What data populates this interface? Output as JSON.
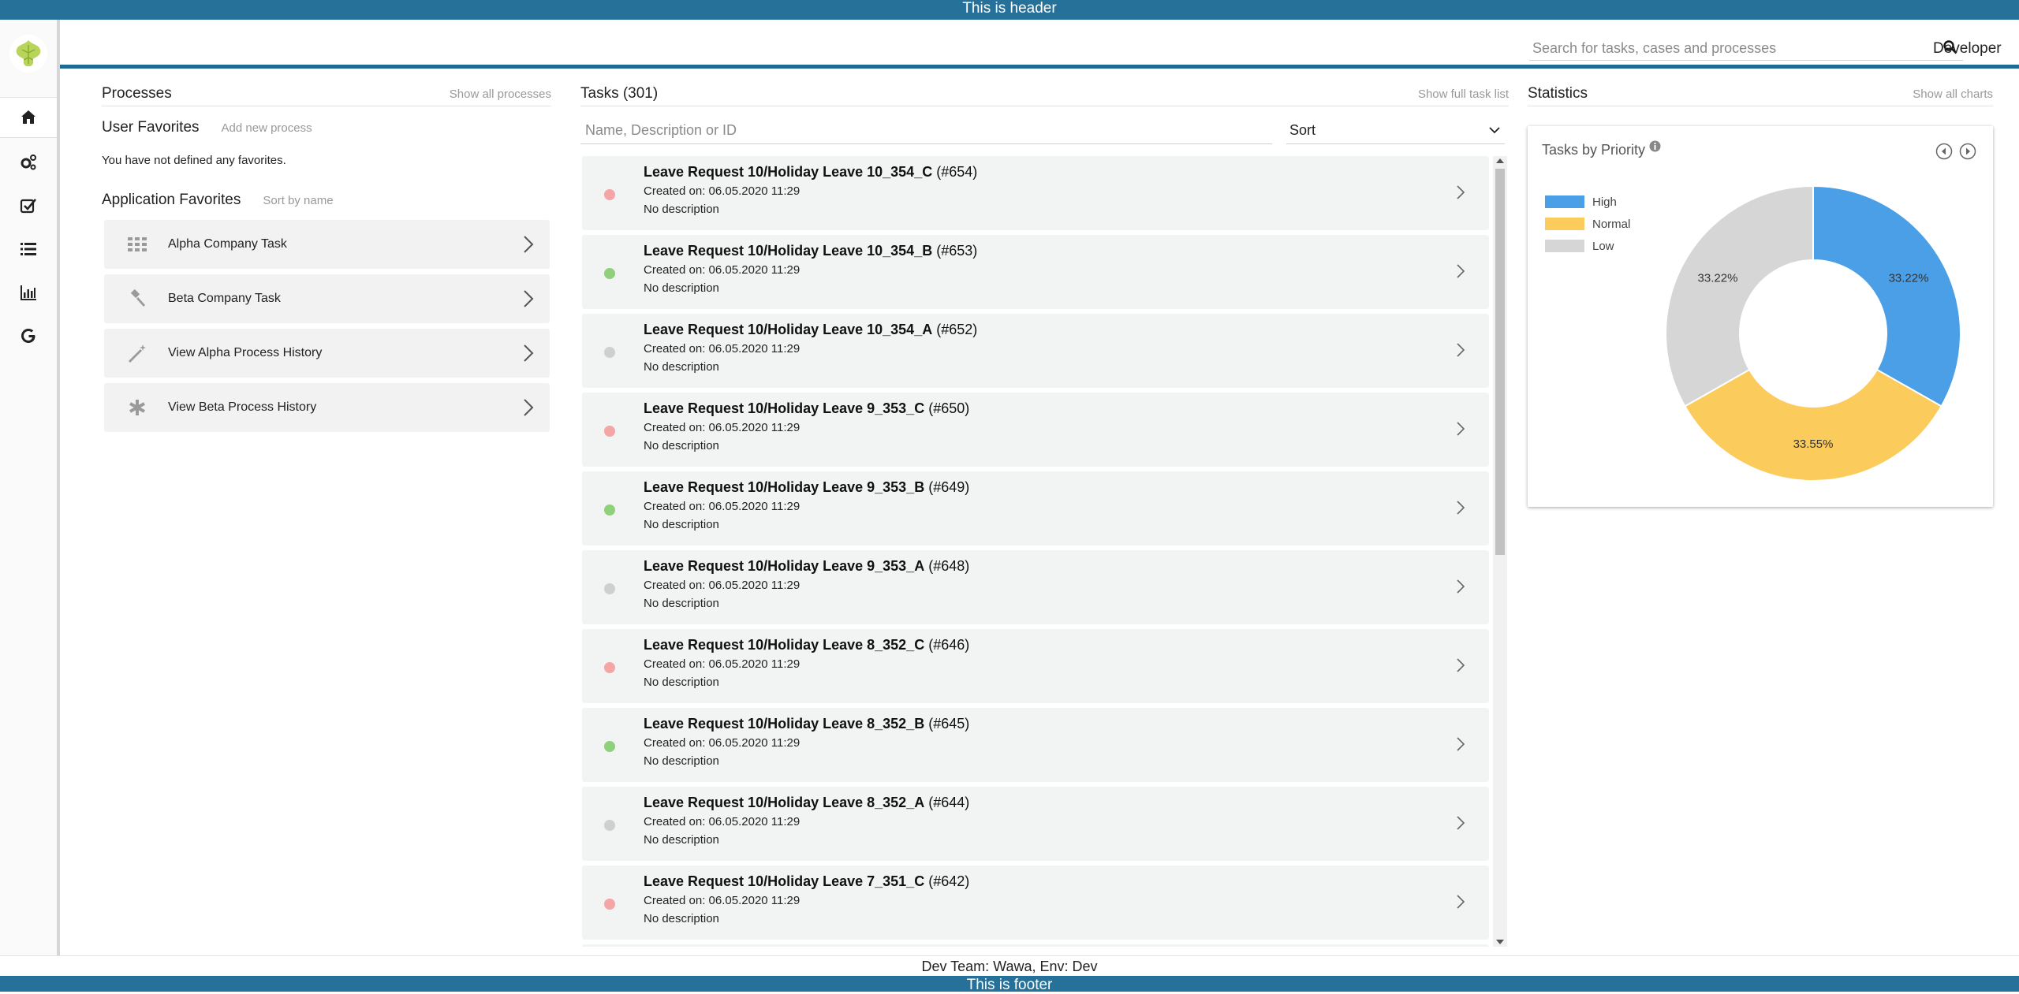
{
  "frame": {
    "header_text": "This is header",
    "footer_text": "This is footer",
    "env_text": "Dev Team: Wawa, Env: Dev"
  },
  "topnav": {
    "search_placeholder": "Search for tasks, cases and processes",
    "user": "Developer"
  },
  "rail": {
    "items": [
      {
        "icon": "home-icon",
        "active": true
      },
      {
        "icon": "gears-icon",
        "active": false
      },
      {
        "icon": "task-check-icon",
        "active": false
      },
      {
        "icon": "list-icon",
        "active": false
      },
      {
        "icon": "bar-chart-icon",
        "active": false
      },
      {
        "icon": "google-icon",
        "active": false
      }
    ]
  },
  "processes": {
    "title": "Processes",
    "show_all": "Show all processes",
    "user_favorites": {
      "title": "User Favorites",
      "action": "Add new process",
      "empty": "You have not defined any favorites."
    },
    "app_favorites": {
      "title": "Application Favorites",
      "action": "Sort by name",
      "items": [
        {
          "label": "Alpha Company Task",
          "icon": "grid-icon"
        },
        {
          "label": "Beta Company Task",
          "icon": "gavel-icon"
        },
        {
          "label": "View Alpha Process History",
          "icon": "magic-wand-icon"
        },
        {
          "label": "View Beta Process History",
          "icon": "asterisk-icon"
        }
      ]
    }
  },
  "tasks": {
    "title": "Tasks (301)",
    "show_all": "Show full task list",
    "filter_placeholder": "Name, Description or ID",
    "sort_label": "Sort",
    "items": [
      {
        "name": "Leave Request 10/Holiday Leave 10_354_C",
        "id": "(#654)",
        "created": "Created on: 06.05.2020 11:29",
        "desc": "No description",
        "priority_color": "#f4a6a6"
      },
      {
        "name": "Leave Request 10/Holiday Leave 10_354_B",
        "id": "(#653)",
        "created": "Created on: 06.05.2020 11:29",
        "desc": "No description",
        "priority_color": "#8ed17a"
      },
      {
        "name": "Leave Request 10/Holiday Leave 10_354_A",
        "id": "(#652)",
        "created": "Created on: 06.05.2020 11:29",
        "desc": "No description",
        "priority_color": "#cfcfcf"
      },
      {
        "name": "Leave Request 10/Holiday Leave 9_353_C",
        "id": "(#650)",
        "created": "Created on: 06.05.2020 11:29",
        "desc": "No description",
        "priority_color": "#f4a6a6"
      },
      {
        "name": "Leave Request 10/Holiday Leave 9_353_B",
        "id": "(#649)",
        "created": "Created on: 06.05.2020 11:29",
        "desc": "No description",
        "priority_color": "#8ed17a"
      },
      {
        "name": "Leave Request 10/Holiday Leave 9_353_A",
        "id": "(#648)",
        "created": "Created on: 06.05.2020 11:29",
        "desc": "No description",
        "priority_color": "#cfcfcf"
      },
      {
        "name": "Leave Request 10/Holiday Leave 8_352_C",
        "id": "(#646)",
        "created": "Created on: 06.05.2020 11:29",
        "desc": "No description",
        "priority_color": "#f4a6a6"
      },
      {
        "name": "Leave Request 10/Holiday Leave 8_352_B",
        "id": "(#645)",
        "created": "Created on: 06.05.2020 11:29",
        "desc": "No description",
        "priority_color": "#8ed17a"
      },
      {
        "name": "Leave Request 10/Holiday Leave 8_352_A",
        "id": "(#644)",
        "created": "Created on: 06.05.2020 11:29",
        "desc": "No description",
        "priority_color": "#cfcfcf"
      },
      {
        "name": "Leave Request 10/Holiday Leave 7_351_C",
        "id": "(#642)",
        "created": "Created on: 06.05.2020 11:29",
        "desc": "No description",
        "priority_color": "#f4a6a6"
      }
    ]
  },
  "statistics": {
    "title": "Statistics",
    "show_all": "Show all charts",
    "chart_title": "Tasks by Priority"
  },
  "chart_data": {
    "type": "pie",
    "title": "Tasks by Priority",
    "categories": [
      "High",
      "Normal",
      "Low"
    ],
    "values": [
      33.22,
      33.55,
      33.22
    ],
    "value_labels": [
      "33.22%",
      "33.55%",
      "33.22%"
    ],
    "colors": [
      "#4a9fe6",
      "#fbcb5c",
      "#d6d6d6"
    ],
    "donut": true,
    "legend": "left"
  }
}
